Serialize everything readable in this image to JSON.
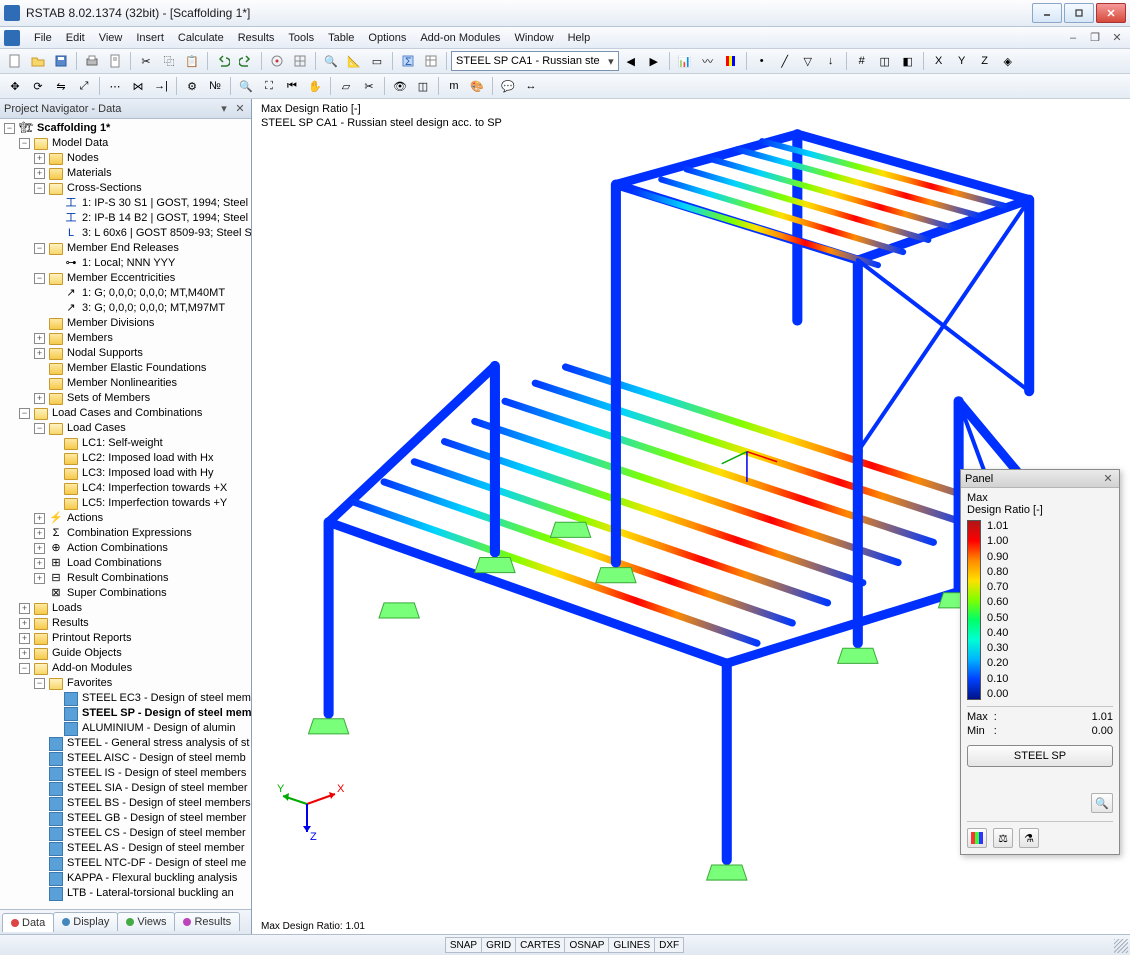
{
  "titlebar": {
    "title": "RSTAB 8.02.1374 (32bit) - [Scaffolding 1*]"
  },
  "menu": {
    "items": [
      "File",
      "Edit",
      "View",
      "Insert",
      "Calculate",
      "Results",
      "Tools",
      "Table",
      "Options",
      "Add-on Modules",
      "Window",
      "Help"
    ]
  },
  "toolbar1": {
    "combo": "STEEL SP CA1 - Russian ste"
  },
  "navigator": {
    "title": "Project Navigator - Data",
    "root": "Scaffolding 1*",
    "model_data": {
      "label": "Model Data",
      "nodes": "Nodes",
      "materials": "Materials",
      "cross_sections": {
        "label": "Cross-Sections",
        "items": [
          "1: IP-S 30 S1 | GOST, 1994; Steel",
          "2: IP-B 14 B2 | GOST, 1994; Steel",
          "3: L 60x6 | GOST 8509-93; Steel S"
        ]
      },
      "member_end_releases": {
        "label": "Member End Releases",
        "items": [
          "1: Local; NNN YYY"
        ]
      },
      "member_eccentricities": {
        "label": "Member Eccentricities",
        "items": [
          "1: G; 0,0,0; 0,0,0; MT,M40MT",
          "3: G; 0,0,0; 0,0,0; MT,M97MT"
        ]
      },
      "member_divisions": "Member Divisions",
      "members": "Members",
      "nodal_supports": "Nodal Supports",
      "member_elastic_foundations": "Member Elastic Foundations",
      "member_nonlinearities": "Member Nonlinearities",
      "sets_of_members": "Sets of Members"
    },
    "load_cases_comb": {
      "label": "Load Cases and Combinations",
      "load_cases": {
        "label": "Load Cases",
        "items": [
          "LC1: Self-weight",
          "LC2: Imposed load with Hx",
          "LC3: Imposed load with Hy",
          "LC4: Imperfection towards +X",
          "LC5: Imperfection towards +Y"
        ]
      },
      "actions": "Actions",
      "comb_expr": "Combination Expressions",
      "action_comb": "Action Combinations",
      "load_comb": "Load Combinations",
      "result_comb": "Result Combinations",
      "super_comb": "Super Combinations"
    },
    "loads": "Loads",
    "results": "Results",
    "printout": "Printout Reports",
    "guide": "Guide Objects",
    "addon": {
      "label": "Add-on Modules",
      "favorites": {
        "label": "Favorites",
        "items": [
          "STEEL EC3 - Design of steel mem",
          "STEEL SP - Design of steel mem",
          "ALUMINIUM - Design of alumin"
        ]
      },
      "modules": [
        "STEEL - General stress analysis of st",
        "STEEL AISC - Design of steel memb",
        "STEEL IS - Design of steel members",
        "STEEL SIA - Design of steel member",
        "STEEL BS - Design of steel members",
        "STEEL GB - Design of steel member",
        "STEEL CS - Design of steel member",
        "STEEL AS - Design of steel member",
        "STEEL NTC-DF - Design of steel me",
        "KAPPA - Flexural buckling analysis",
        "LTB - Lateral-torsional buckling an"
      ]
    },
    "tabs": [
      "Data",
      "Display",
      "Views",
      "Results"
    ]
  },
  "viewport": {
    "line1": "Max Design Ratio [-]",
    "line2": "STEEL SP CA1 - Russian steel design acc. to SP",
    "status": "Max Design Ratio: 1.01",
    "axes": {
      "x": "X",
      "y": "Y",
      "z": "Z"
    }
  },
  "panel": {
    "title": "Panel",
    "max_label": "Max",
    "ratio_label": "Design Ratio [-]",
    "legend": [
      "1.01",
      "1.00",
      "0.90",
      "0.80",
      "0.70",
      "0.60",
      "0.50",
      "0.40",
      "0.30",
      "0.20",
      "0.10",
      "0.00"
    ],
    "info": {
      "max_label": "Max",
      "max_val": "1.01",
      "min_label": "Min",
      "min_val": "0.00"
    },
    "button": "STEEL SP"
  },
  "statusbar": [
    "SNAP",
    "GRID",
    "CARTES",
    "OSNAP",
    "GLINES",
    "DXF"
  ]
}
